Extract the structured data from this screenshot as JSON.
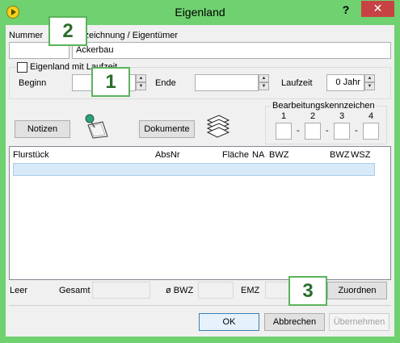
{
  "window": {
    "title": "Eigenland",
    "help_label": "?",
    "close_label": "✕"
  },
  "header": {
    "nummer_label": "Nummer",
    "bezeichnung_label": "Bezeichnung / Eigentümer",
    "nummer_value": "",
    "bezeichnung_value": "Ackerbau"
  },
  "laufzeit_group": {
    "checkbox_label": "Eigenland mit Laufzeit",
    "checkbox_checked": false,
    "beginn_label": "Beginn",
    "beginn_value": "",
    "ende_label": "Ende",
    "ende_value": "",
    "laufzeit_label": "Laufzeit",
    "laufzeit_value": "0 Jahr"
  },
  "actions": {
    "notizen_label": "Notizen",
    "dokumente_label": "Dokumente"
  },
  "bearbeitung": {
    "title": "Bearbeitungskennzeichen",
    "numbers": [
      "1",
      "2",
      "3",
      "4"
    ],
    "separator": "-"
  },
  "table": {
    "columns": [
      "Flurstück",
      "AbsNr",
      "Fläche",
      "NA",
      "BWZ",
      "BWZ",
      "WSZ"
    ],
    "rows": []
  },
  "footer": {
    "leer_label": "Leer",
    "gesamt_label": "Gesamt",
    "bwz_label": "ø BWZ",
    "emz_label": "EMZ",
    "zuordnen_label": "Zuordnen"
  },
  "buttons": {
    "ok_label": "OK",
    "abbrechen_label": "Abbrechen",
    "uebernehmen_label": "Übernehmen"
  },
  "badges": [
    "1",
    "2",
    "3"
  ]
}
